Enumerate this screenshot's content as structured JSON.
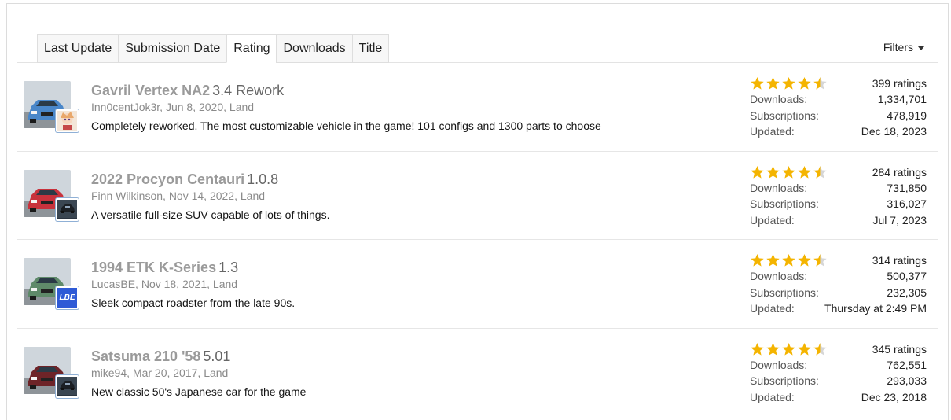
{
  "tabs": [
    {
      "label": "Last Update",
      "active": false
    },
    {
      "label": "Submission Date",
      "active": false
    },
    {
      "label": "Rating",
      "active": true
    },
    {
      "label": "Downloads",
      "active": false
    },
    {
      "label": "Title",
      "active": false
    }
  ],
  "filters_label": "Filters",
  "labels": {
    "downloads": "Downloads:",
    "subscriptions": "Subscriptions:",
    "updated": "Updated:"
  },
  "items": [
    {
      "title": "Gavril Vertex NA2",
      "version": "3.4 Rework",
      "author": "Inn0centJok3r",
      "date": "Jun 8, 2020",
      "category": "Land",
      "description": "Completely reworked. The most customizable vehicle in the game! 101 configs and 1300 parts to choose",
      "stars": 4.5,
      "ratings": "399 ratings",
      "downloads": "1,334,701",
      "subscriptions": "478,919",
      "updated": "Dec 18, 2023",
      "car_color": "#4a87c9",
      "avatar_icon": "anime-avatar-icon"
    },
    {
      "title": "2022 Procyon Centauri",
      "version": "1.0.8",
      "author": "Finn Wilkinson",
      "date": "Nov 14, 2022",
      "category": "Land",
      "description": "A versatile full-size SUV capable of lots of things.",
      "stars": 4.5,
      "ratings": "284 ratings",
      "downloads": "731,850",
      "subscriptions": "316,027",
      "updated": "Jul 7, 2023",
      "car_color": "#c8323c",
      "avatar_icon": "car-avatar-icon"
    },
    {
      "title": "1994 ETK K-Series",
      "version": "1.3",
      "author": "LucasBE",
      "date": "Nov 18, 2021",
      "category": "Land",
      "description": "Sleek compact roadster from the late 90s.",
      "stars": 4.5,
      "ratings": "314 ratings",
      "downloads": "500,377",
      "subscriptions": "232,305",
      "updated": "Thursday at 2:49 PM",
      "car_color": "#5f8a6a",
      "avatar_icon": "lbe-logo-icon",
      "avatar_text": "LBE"
    },
    {
      "title": "Satsuma 210 '58",
      "version": "5.01",
      "author": "mike94",
      "date": "Mar 20, 2017",
      "category": "Land",
      "description": "New classic 50's Japanese car for the game",
      "stars": 4.5,
      "ratings": "345 ratings",
      "downloads": "762,551",
      "subscriptions": "293,033",
      "updated": "Dec 23, 2018",
      "car_color": "#6e2428",
      "avatar_icon": "car-avatar-icon"
    }
  ],
  "colors": {
    "star": "#f4b400",
    "star_empty": "#d6d6d6",
    "title_gray": "#9a9a9a"
  }
}
